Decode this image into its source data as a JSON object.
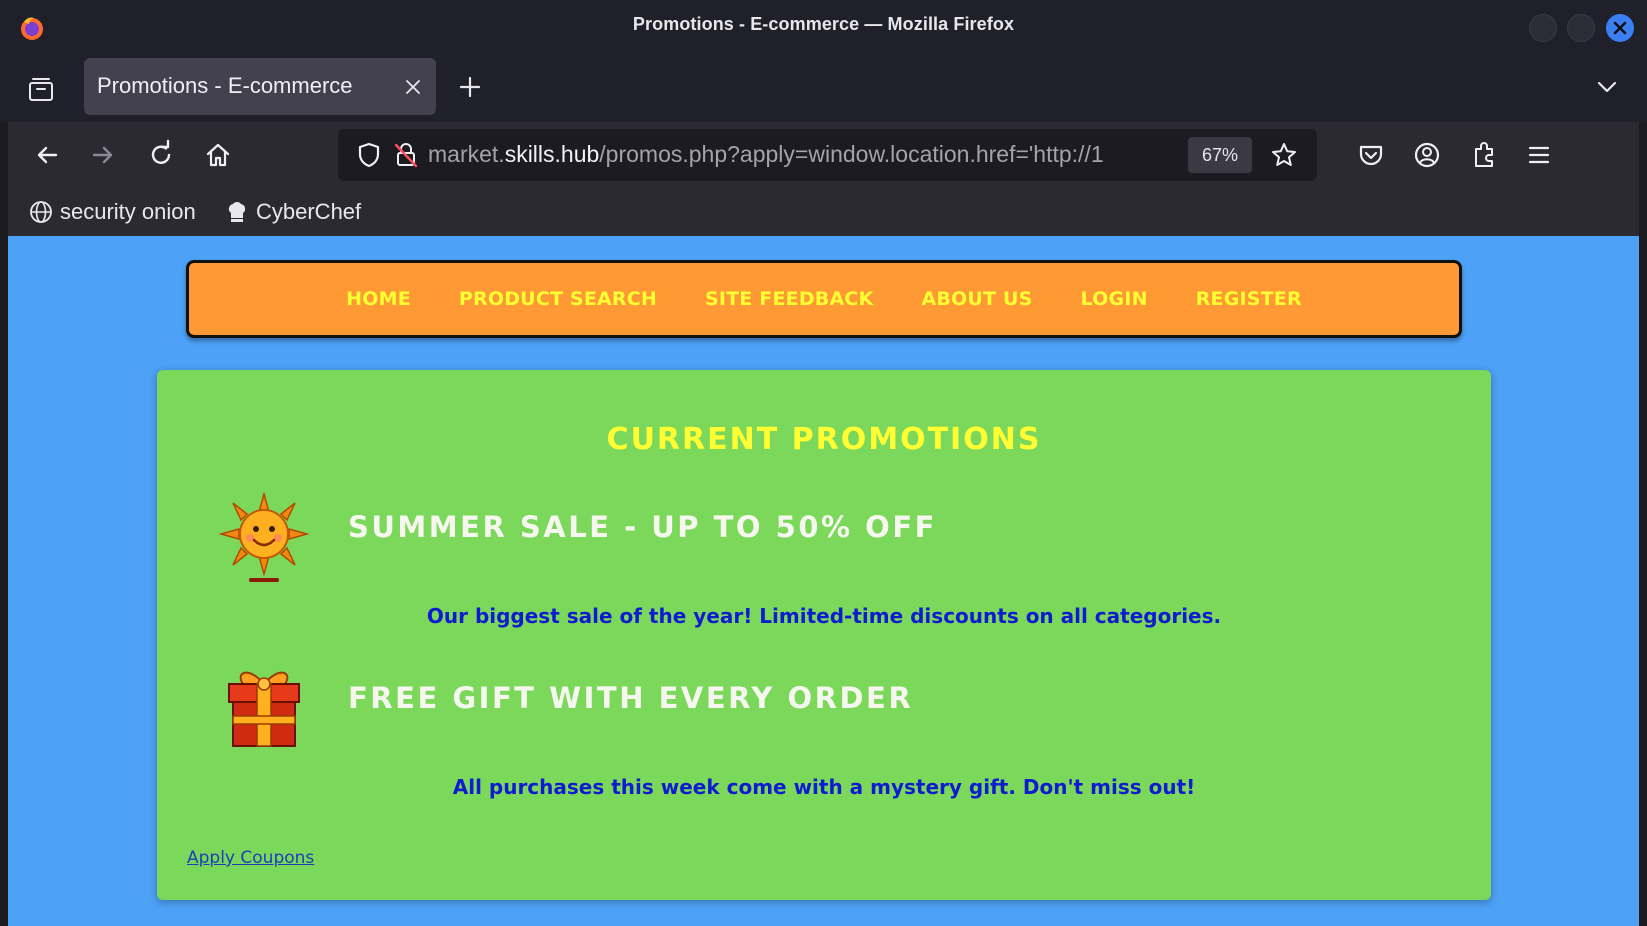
{
  "window": {
    "title": "Promotions - E-commerce — Mozilla Firefox"
  },
  "tabs": [
    {
      "label": "Promotions - E-commerce",
      "active": true
    }
  ],
  "toolbar": {
    "url_prefix": "market.",
    "url_host": "skills.hub",
    "url_path": "/promos.php?apply=window.location.href='http://1",
    "zoom": "67%"
  },
  "bookmarks": [
    {
      "label": "security onion",
      "icon": "globe-icon"
    },
    {
      "label": "CyberChef",
      "icon": "chef-hat-icon"
    }
  ],
  "site_nav": {
    "items": [
      "HOME",
      "PRODUCT SEARCH",
      "SITE FEEDBACK",
      "ABOUT US",
      "LOGIN",
      "REGISTER"
    ]
  },
  "promotions": {
    "heading": "CURRENT PROMOTIONS",
    "items": [
      {
        "icon": "sun-icon",
        "title": "SUMMER SALE - UP TO 50% OFF",
        "description": "Our biggest sale of the year! Limited-time discounts on all categories."
      },
      {
        "icon": "gift-icon",
        "title": "FREE GIFT WITH EVERY ORDER",
        "description": "All purchases this week come with a mystery gift. Don't miss out!"
      }
    ],
    "apply_link": "Apply Coupons"
  },
  "colors": {
    "page_bg": "#4da1f6",
    "nav_bg": "#ff9933",
    "nav_text": "#ffff33",
    "promo_bg": "#7cd85a",
    "desc_text": "#0e1bd0"
  }
}
